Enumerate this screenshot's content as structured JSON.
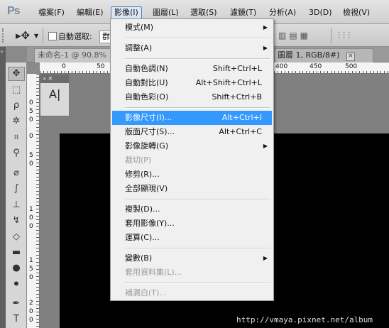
{
  "app": {
    "logo": "Ps"
  },
  "menubar": [
    {
      "label": "檔案(F)"
    },
    {
      "label": "編輯(E)"
    },
    {
      "label": "影像(I)"
    },
    {
      "label": "圖層(L)"
    },
    {
      "label": "選取(S)"
    },
    {
      "label": "濾鏡(T)"
    },
    {
      "label": "分析(A)"
    },
    {
      "label": "3D(D)"
    },
    {
      "label": "檢視(V)"
    }
  ],
  "options": {
    "auto_select_label": "自動選取:",
    "auto_select_value": "群組"
  },
  "document": {
    "tab_title": "未命名-1 @ 90.8%",
    "tab2_title": "圖層 1, RGB/8#)",
    "ruler_top": [
      "0",
      "50",
      "400",
      "450",
      "500"
    ],
    "ruler_left": [
      "0",
      "5",
      "0",
      "0",
      "5",
      "0",
      "1",
      "0",
      "0",
      "1",
      "5",
      "0",
      "2",
      "0",
      "0"
    ]
  },
  "mini_panel": {
    "glyph": "A|"
  },
  "image_menu": {
    "items": [
      {
        "label": "模式(M)",
        "submenu": true
      },
      {
        "label": "調整(A)",
        "submenu": true
      },
      {
        "label": "自動色調(N)",
        "shortcut": "Shift+Ctrl+L"
      },
      {
        "label": "自動對比(U)",
        "shortcut": "Alt+Shift+Ctrl+L"
      },
      {
        "label": "自動色彩(O)",
        "shortcut": "Shift+Ctrl+B"
      },
      {
        "label": "影像尺寸(I)...",
        "shortcut": "Alt+Ctrl+I",
        "highlighted": true
      },
      {
        "label": "版面尺寸(S)...",
        "shortcut": "Alt+Ctrl+C"
      },
      {
        "label": "影像旋轉(G)",
        "submenu": true
      },
      {
        "label": "裁切(P)",
        "disabled": true
      },
      {
        "label": "修剪(R)..."
      },
      {
        "label": "全部顯現(V)"
      },
      {
        "label": "複製(D)..."
      },
      {
        "label": "套用影像(Y)..."
      },
      {
        "label": "運算(C)..."
      },
      {
        "label": "變數(B)",
        "submenu": true
      },
      {
        "label": "套用資料集(L)...",
        "disabled": true
      },
      {
        "label": "補漏白(T)...",
        "disabled": true
      }
    ]
  },
  "watermark": "http://vmaya.pixnet.net/album"
}
